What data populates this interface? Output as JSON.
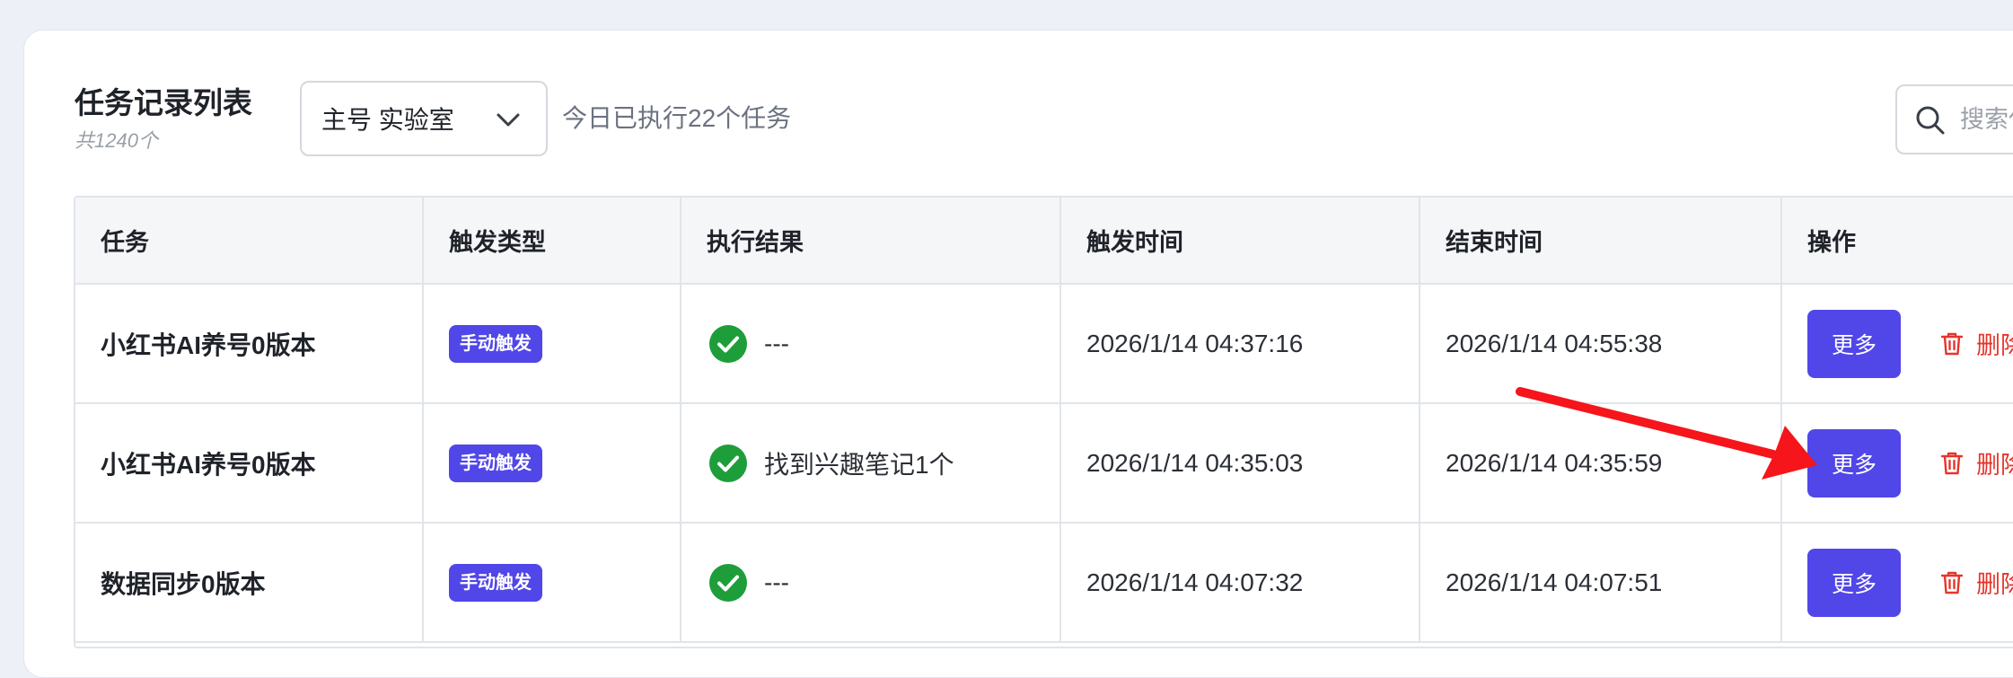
{
  "header": {
    "title": "任务记录列表",
    "subtitle": "共1240个",
    "account_select": {
      "value": "主号 实验室"
    },
    "daily_status": "今日已执行22个任务",
    "search": {
      "placeholder": "搜索任务"
    }
  },
  "table": {
    "columns": [
      "任务",
      "触发类型",
      "执行结果",
      "触发时间",
      "结束时间",
      "操作"
    ],
    "rows": [
      {
        "task": "小红书AI养号0版本",
        "trigger_type": "手动触发",
        "result": "---",
        "trigger_time": "2026/1/14 04:37:16",
        "end_time": "2026/1/14 04:55:38",
        "more_label": "更多",
        "delete_label": "删除"
      },
      {
        "task": "小红书AI养号0版本",
        "trigger_type": "手动触发",
        "result": "找到兴趣笔记1个",
        "trigger_time": "2026/1/14 04:35:03",
        "end_time": "2026/1/14 04:35:59",
        "more_label": "更多",
        "delete_label": "删除"
      },
      {
        "task": "数据同步0版本",
        "trigger_type": "手动触发",
        "result": "---",
        "trigger_time": "2026/1/14 04:07:32",
        "end_time": "2026/1/14 04:07:51",
        "more_label": "更多",
        "delete_label": "删除"
      }
    ]
  },
  "icons": {
    "select": "chevron-down-icon",
    "search": "search-icon",
    "result": "check-circle-icon",
    "delete": "trash-icon",
    "annotation": "red-arrow-icon"
  },
  "colors": {
    "primary": "#5146e8",
    "success": "#1e9e3a",
    "danger": "#e5352b",
    "annotation_arrow": "#f5151a"
  }
}
